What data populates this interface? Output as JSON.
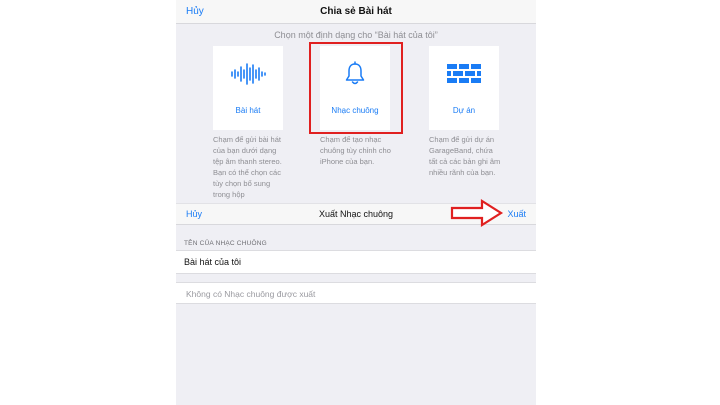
{
  "share_sheet": {
    "cancel_label": "Hủy",
    "title": "Chia sẻ Bài hát",
    "prompt": "Chọn một định dạng cho “Bài hát của tôi”"
  },
  "formats": [
    {
      "label": "Bài hát",
      "icon": "waveform-icon",
      "description": "Chạm để gửi bài hát của bạn dưới dạng tệp âm thanh stereo. Bạn có thể chọn các tùy chọn bổ sung trong hộp"
    },
    {
      "label": "Nhạc chuông",
      "icon": "bell-icon",
      "description": "Chạm để tạo nhạc chuông tùy chỉnh cho iPhone của bạn."
    },
    {
      "label": "Dự án",
      "icon": "brick-wall-icon",
      "description": "Chạm để gửi dự án GarageBand, chứa tất cả các bản ghi âm nhiều rãnh của bạn."
    }
  ],
  "export_bar": {
    "cancel_label": "Hủy",
    "title": "Xuất Nhạc chuông",
    "export_label": "Xuất"
  },
  "ringtone_name": {
    "section_header": "TÊN CỦA NHẠC CHUÔNG",
    "value": "Bài hát của tôi"
  },
  "exported_list": {
    "empty_text": "Không có Nhạc chuông được xuất"
  },
  "colors": {
    "accent": "#1a7cf5",
    "highlight": "#e02020",
    "background": "#efeff4"
  }
}
